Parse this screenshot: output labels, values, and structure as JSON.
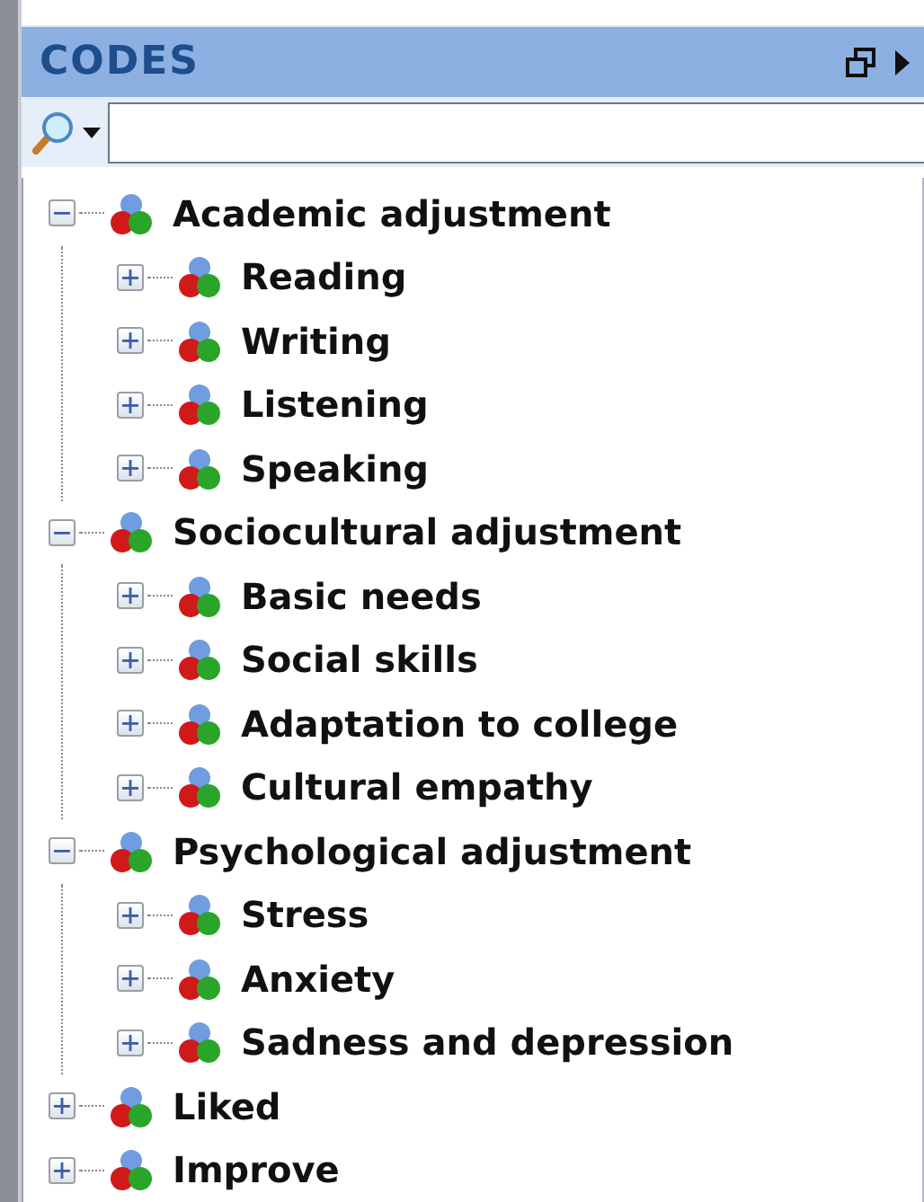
{
  "panel": {
    "title": "CODES"
  },
  "tree": [
    {
      "label": "Academic adjustment",
      "expanded": true,
      "children": [
        {
          "label": "Reading",
          "expanded": false
        },
        {
          "label": "Writing",
          "expanded": false
        },
        {
          "label": "Listening",
          "expanded": false
        },
        {
          "label": "Speaking",
          "expanded": false
        }
      ]
    },
    {
      "label": "Sociocultural adjustment",
      "expanded": true,
      "children": [
        {
          "label": "Basic needs",
          "expanded": false
        },
        {
          "label": "Social skills",
          "expanded": false
        },
        {
          "label": "Adaptation to college",
          "expanded": false
        },
        {
          "label": "Cultural empathy",
          "expanded": false
        }
      ]
    },
    {
      "label": "Psychological adjustment",
      "expanded": true,
      "children": [
        {
          "label": "Stress",
          "expanded": false
        },
        {
          "label": "Anxiety",
          "expanded": false
        },
        {
          "label": "Sadness and depression",
          "expanded": false
        }
      ]
    },
    {
      "label": "Liked",
      "expanded": false
    },
    {
      "label": "Improve",
      "expanded": false
    }
  ]
}
